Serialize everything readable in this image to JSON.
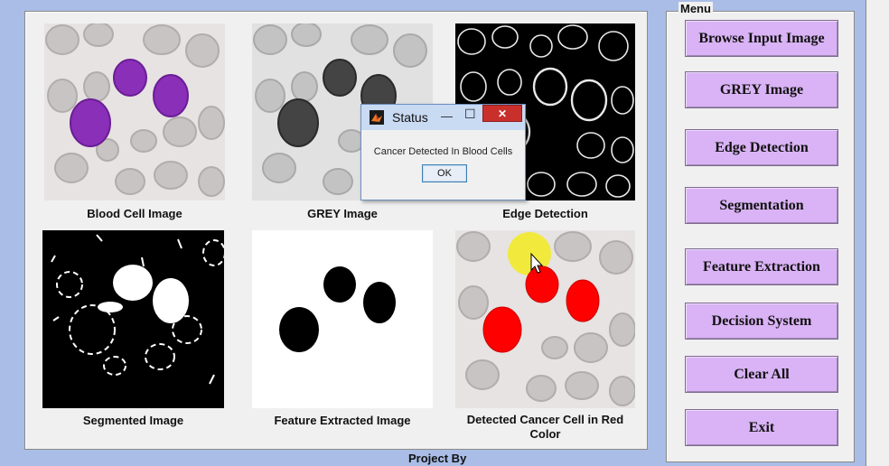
{
  "images": [
    {
      "caption": "Blood Cell Image"
    },
    {
      "caption": "GREY Image"
    },
    {
      "caption": "Edge Detection"
    },
    {
      "caption": "Segmented Image"
    },
    {
      "caption": "Feature Extracted Image"
    },
    {
      "caption": "Detected Cancer Cell in Red Color"
    }
  ],
  "footer": {
    "text": "Project By"
  },
  "menu": {
    "title": "Menu",
    "buttons": [
      "Browse Input Image",
      "GREY Image",
      "Edge Detection",
      "Segmentation",
      "Feature Extraction",
      "Decision System",
      "Clear All",
      "Exit"
    ]
  },
  "dialog": {
    "title": "Status",
    "message": "Cancer Detected In Blood Cells",
    "ok_label": "OK",
    "minimize_glyph": "—",
    "maximize_glyph": "☐",
    "close_glyph": "✕"
  },
  "colors": {
    "button": "#d9b3f5",
    "close": "#c9302c",
    "purple_cell": "#8a2fb8",
    "red_cell": "#ff0000",
    "highlight": "#f2ea2a"
  }
}
